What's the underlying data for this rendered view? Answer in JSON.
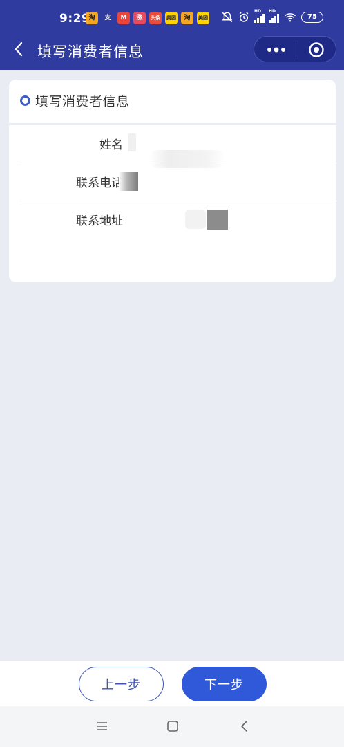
{
  "status_bar": {
    "time": "9:29",
    "app_icons": [
      {
        "label": "淘",
        "color": "#f5a623"
      },
      {
        "label": "支",
        "color": "#2f3b9f"
      },
      {
        "label": "M",
        "color": "#e8463c"
      },
      {
        "label": "涨",
        "color": "#e84a5f"
      },
      {
        "label": "头条",
        "color": "#e74c3c"
      },
      {
        "label": "美团",
        "color": "#ffd100"
      },
      {
        "label": "淘",
        "color": "#f5a623"
      },
      {
        "label": "美团",
        "color": "#ffd100"
      }
    ],
    "signal_label_1": "HD",
    "signal_label_2": "HD",
    "battery": "75"
  },
  "header": {
    "title": "填写消费者信息"
  },
  "section": {
    "title": "填写消费者信息"
  },
  "form": {
    "rows": [
      {
        "label": "姓名",
        "value": ""
      },
      {
        "label": "联系电话",
        "value": ""
      },
      {
        "label": "联系地址",
        "value": ""
      }
    ]
  },
  "footer": {
    "prev_label": "上一步",
    "next_label": "下一步"
  },
  "colors": {
    "header_blue": "#2f3b9f",
    "accent_blue": "#2f59d8",
    "page_bg": "#e9ecf2"
  }
}
